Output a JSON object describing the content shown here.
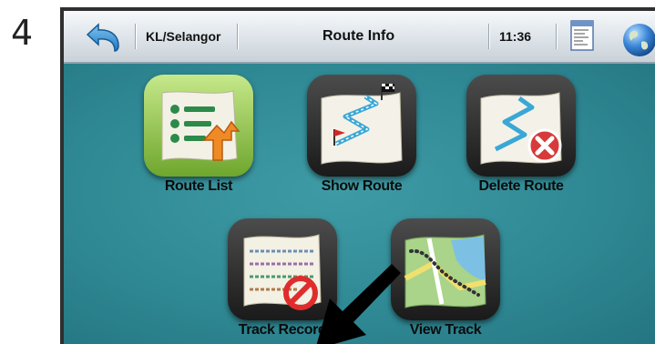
{
  "step_number": "4",
  "header": {
    "region": "KL/Selangor",
    "title": "Route Info",
    "time": "11:36"
  },
  "icons": {
    "back": "back-arrow-icon",
    "document": "document-icon",
    "globe": "globe-icon"
  },
  "menu": {
    "items": [
      {
        "label": "Route List",
        "icon": "route-list-icon"
      },
      {
        "label": "Show Route",
        "icon": "show-route-icon"
      },
      {
        "label": "Delete Route",
        "icon": "delete-route-icon"
      },
      {
        "label": "Track Record",
        "icon": "track-record-icon"
      },
      {
        "label": "View Track",
        "icon": "view-track-icon"
      }
    ]
  },
  "colors": {
    "background": "#2f8994",
    "titlebar": "#dfe5ea",
    "highlight_tile": "#8cc63f",
    "pointer_arrow": "#000000"
  }
}
